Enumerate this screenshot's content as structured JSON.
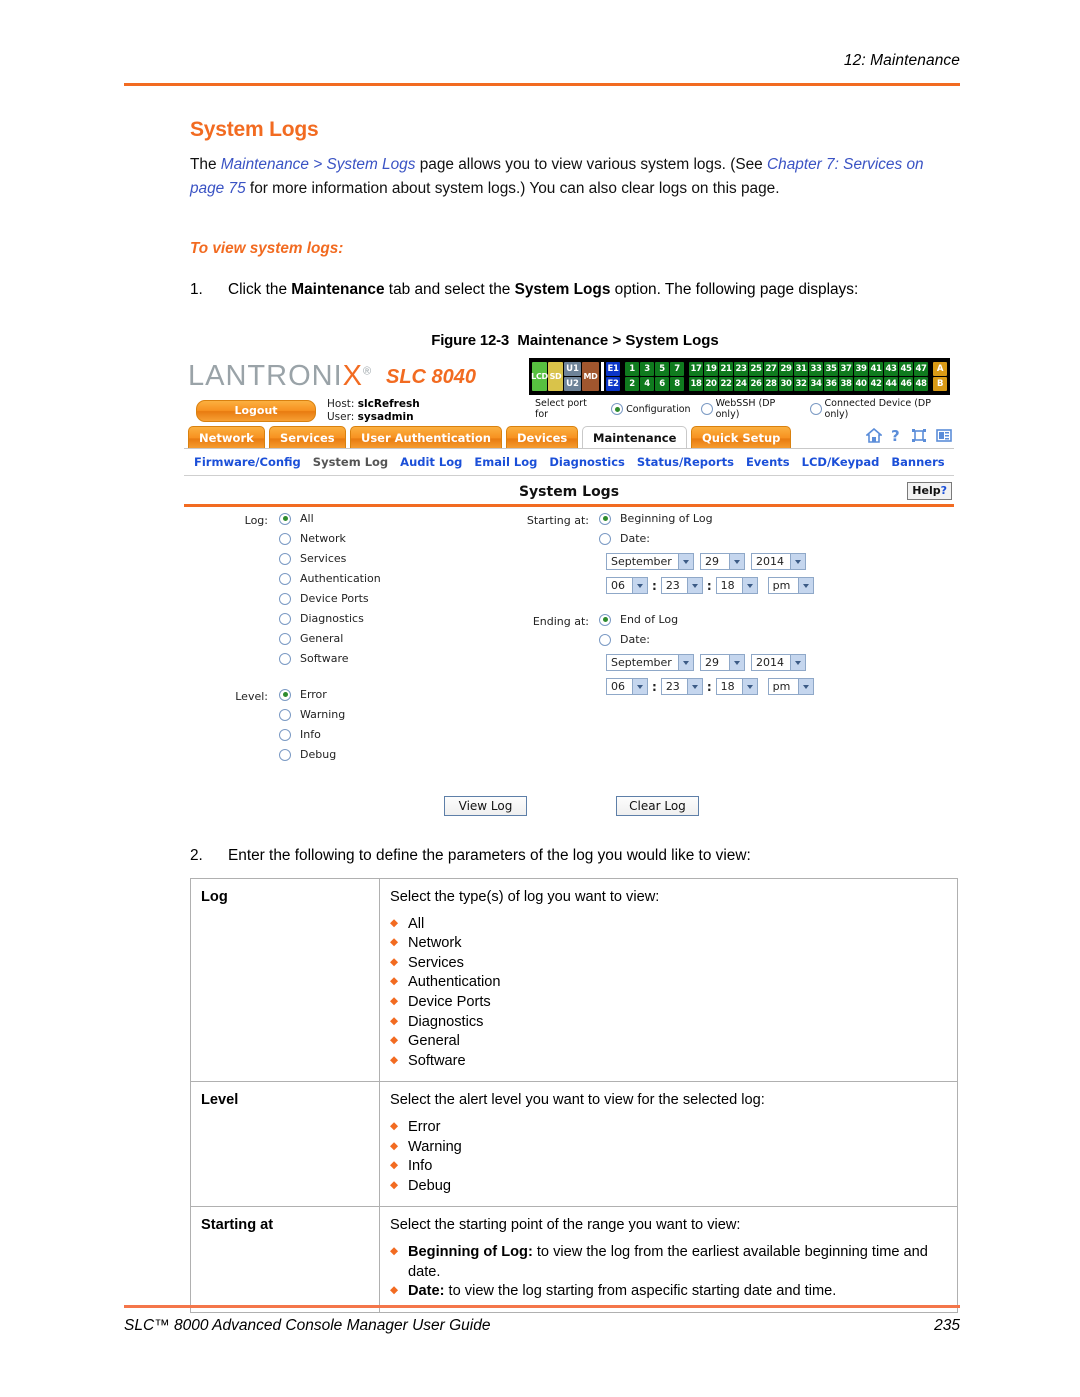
{
  "page": {
    "running_head": "12: Maintenance",
    "footer_title": "SLC™ 8000 Advanced Console Manager User Guide",
    "footer_page_number": "235",
    "accent_orange": "#F26B21",
    "link_blue": "#3A53C4"
  },
  "content": {
    "heading": "System Logs",
    "intro_before": "The ",
    "intro_link1": "Maintenance > System Logs",
    "intro_mid1": " page allows you to view various system logs. (See ",
    "intro_link2": "Chapter 7: Services on page 75",
    "intro_mid2": " for more information about system logs.) You can also clear logs on this page.",
    "subheading": "To view system logs:",
    "step1_number": "1.",
    "step1_text_a": "Click the ",
    "step1_bold_a": "Maintenance",
    "step1_text_b": " tab and select the ",
    "step1_bold_b": "System Logs",
    "step1_text_c": " option. The following page displays:",
    "step2_number": "2.",
    "step2_text": "Enter the following to define the parameters of the log you would like to view:",
    "figure_number": "Figure 12-3",
    "figure_title": "Maintenance > System Logs"
  },
  "screenshot": {
    "logo_text_a": "LANTRONI",
    "logo_text_x": "X",
    "logo_registered": "®",
    "model": "SLC 8040",
    "logout_label": "Logout",
    "host_label": "Host:",
    "host_value": "slcRefresh",
    "user_label": "User:",
    "user_value": "sysadmin",
    "portmap": {
      "lcd": "LCD",
      "sd": "SD",
      "u1": "U1",
      "u2": "U2",
      "md": "MD",
      "e1": "E1",
      "e2": "E2",
      "row1_group1": [
        "1",
        "3",
        "5",
        "7"
      ],
      "row2_group1": [
        "2",
        "4",
        "6",
        "8"
      ],
      "row1_group2": [
        "17",
        "19",
        "21",
        "23",
        "25",
        "27",
        "29",
        "31",
        "33",
        "35",
        "37",
        "39",
        "41",
        "43",
        "45",
        "47"
      ],
      "row2_group2": [
        "18",
        "20",
        "22",
        "24",
        "26",
        "28",
        "30",
        "32",
        "34",
        "36",
        "38",
        "40",
        "42",
        "44",
        "46",
        "48"
      ],
      "a": "A",
      "b": "B"
    },
    "select_port_label": "Select port for",
    "select_port_options": [
      {
        "label": "Configuration",
        "selected": true
      },
      {
        "label": "WebSSH (DP only)",
        "selected": false
      },
      {
        "label": "Connected Device (DP only)",
        "selected": false
      }
    ],
    "tabs": [
      {
        "label": "Network",
        "active": false
      },
      {
        "label": "Services",
        "active": false
      },
      {
        "label": "User Authentication",
        "active": false
      },
      {
        "label": "Devices",
        "active": false
      },
      {
        "label": "Maintenance",
        "active": true
      },
      {
        "label": "Quick Setup",
        "active": false
      }
    ],
    "nav_icons": [
      "home-icon",
      "help-icon",
      "expand-icon",
      "panel-icon"
    ],
    "subnav": [
      {
        "label": "Firmware/Config",
        "active": false
      },
      {
        "label": "System Log",
        "active": true
      },
      {
        "label": "Audit Log",
        "active": false
      },
      {
        "label": "Email Log",
        "active": false
      },
      {
        "label": "Diagnostics",
        "active": false
      },
      {
        "label": "Status/Reports",
        "active": false
      },
      {
        "label": "Events",
        "active": false
      },
      {
        "label": "LCD/Keypad",
        "active": false
      },
      {
        "label": "Banners",
        "active": false
      }
    ],
    "panel_title": "System Logs",
    "help_label": "Help",
    "help_mark": "?",
    "log_label": "Log:",
    "log_options": [
      {
        "label": "All",
        "selected": true
      },
      {
        "label": "Network",
        "selected": false
      },
      {
        "label": "Services",
        "selected": false
      },
      {
        "label": "Authentication",
        "selected": false
      },
      {
        "label": "Device Ports",
        "selected": false
      },
      {
        "label": "Diagnostics",
        "selected": false
      },
      {
        "label": "General",
        "selected": false
      },
      {
        "label": "Software",
        "selected": false
      }
    ],
    "level_label": "Level:",
    "level_options": [
      {
        "label": "Error",
        "selected": true
      },
      {
        "label": "Warning",
        "selected": false
      },
      {
        "label": "Info",
        "selected": false
      },
      {
        "label": "Debug",
        "selected": false
      }
    ],
    "starting_at_label": "Starting at:",
    "starting_option_1": "Beginning of Log",
    "starting_option_2": "Date:",
    "starting_date": {
      "month": "September",
      "day": "29",
      "year": "2014"
    },
    "starting_time": {
      "hour": "06",
      "minute": "23",
      "second": "18",
      "meridiem": "pm",
      "sep": ":"
    },
    "ending_at_label": "Ending at:",
    "ending_option_1": "End of Log",
    "ending_option_2": "Date:",
    "ending_date": {
      "month": "September",
      "day": "29",
      "year": "2014"
    },
    "ending_time": {
      "hour": "06",
      "minute": "23",
      "second": "18",
      "meridiem": "pm",
      "sep": ":"
    },
    "view_log_button": "View Log",
    "clear_log_button": "Clear Log"
  },
  "param_table": {
    "rows": [
      {
        "key": "Log",
        "desc": "Select the type(s) of log you want to view:",
        "bullets": [
          "All",
          "Network",
          "Services",
          "Authentication",
          "Device Ports",
          "Diagnostics",
          "General",
          "Software"
        ]
      },
      {
        "key": "Level",
        "desc": "Select the alert level you want to view for the selected log:",
        "bullets": [
          "Error",
          "Warning",
          "Info",
          "Debug"
        ]
      },
      {
        "key": "Starting at",
        "desc": "Select the starting point of the range you want to view:",
        "bullets_rich": [
          {
            "bold": "Beginning of Log:",
            "rest": " to view the log from the earliest available beginning time and date."
          },
          {
            "bold": "Date:",
            "rest": " to view the log starting from aspecific starting date and time."
          }
        ]
      }
    ]
  }
}
